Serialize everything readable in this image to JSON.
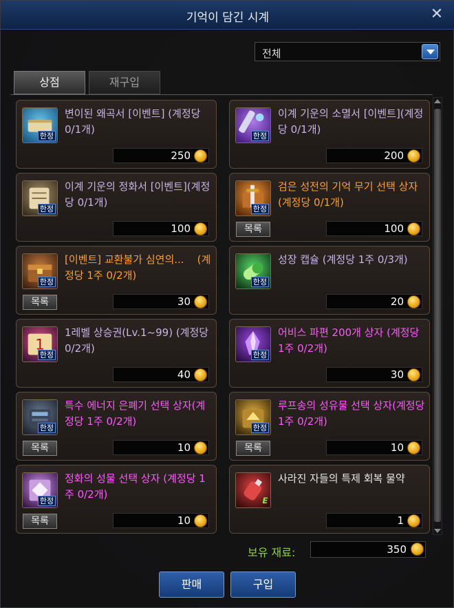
{
  "window": {
    "title": "기억이 담긴 시계"
  },
  "filter": {
    "value": "전체"
  },
  "tabs": [
    {
      "label": "상점"
    },
    {
      "label": "재구입"
    }
  ],
  "badge_text": "한정",
  "list_btn_label": "목록",
  "items": [
    {
      "name": "변이된 왜곡서 [이벤트] (계정당 0/1개)",
      "price": "250",
      "color": "lavender",
      "icon": "scroll-icon",
      "list_btn": false
    },
    {
      "name": "이계 기운의 소멸서 [이벤트](계정당 0/1개)",
      "price": "200",
      "color": "lavender",
      "icon": "purple-scroll-icon",
      "list_btn": false
    },
    {
      "name": "이계 기운의 정화서 [이벤트](계정당 0/1개)",
      "price": "100",
      "color": "lavender",
      "icon": "parchment-icon",
      "list_btn": false
    },
    {
      "name": "검은 성전의 기억 무기 선택 상자(계정당 0/1개)",
      "price": "100",
      "color": "orange",
      "icon": "weapon-box-icon",
      "list_btn": true
    },
    {
      "name": "[이벤트] 교환불가 심연의...    (계정당 1주 0/2개)",
      "price": "30",
      "color": "orange",
      "icon": "chest-icon",
      "list_btn": true
    },
    {
      "name": "성장 캡슐 (계정당 1주 0/3개)",
      "price": "20",
      "color": "lavender",
      "icon": "capsule-icon",
      "list_btn": false
    },
    {
      "name": "1레벨 상승권(Lv.1~99) (계정당 0/2개)",
      "price": "40",
      "color": "lavender",
      "icon": "level-ticket-icon",
      "list_btn": false
    },
    {
      "name": "어비스 파편 200개 상자 (계정당 1주 0/2개)",
      "price": "30",
      "color": "magenta",
      "icon": "abyss-crystal-icon",
      "list_btn": false
    },
    {
      "name": "특수 에너지 은폐기 선택 상자(계정당 1주 0/2개)",
      "price": "10",
      "color": "magenta",
      "icon": "energy-box-icon",
      "list_btn": true
    },
    {
      "name": "루프송의 성유물 선택 상자(계정당 1주 0/2개)",
      "price": "10",
      "color": "magenta",
      "icon": "relic-box-icon",
      "list_btn": true
    },
    {
      "name": "정화의 성물 선택 상자 (계정당 1주 0/2개)",
      "price": "10",
      "color": "magenta",
      "icon": "holy-box-icon",
      "list_btn": true
    },
    {
      "name": "사라진 자들의 특제 회복 물약",
      "price": "1",
      "color": "white",
      "icon": "potion-icon",
      "list_btn": false
    }
  ],
  "owned": {
    "label": "보유 재료:",
    "value": "350"
  },
  "buttons": {
    "sell": "판매",
    "buy": "구입"
  },
  "colors": {
    "lavender": "#c8b4e6",
    "orange": "#ff9f2a",
    "magenta": "#ff58ff",
    "white": "#e6e6e6"
  }
}
